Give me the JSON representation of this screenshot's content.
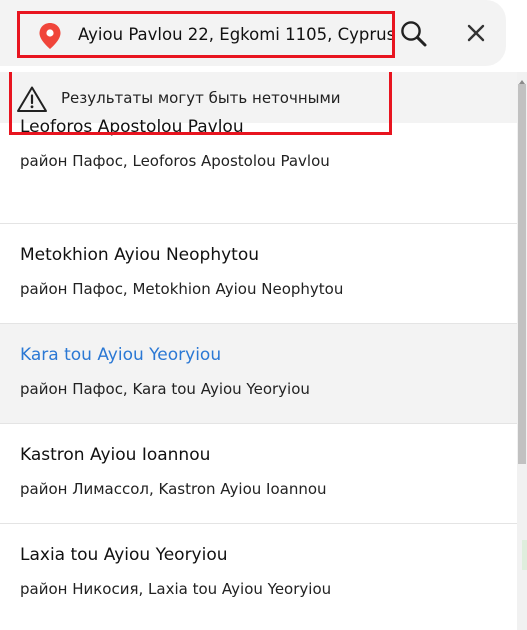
{
  "search": {
    "value": "Ayiou Pavlou 22, Egkomi 1105, Cyprus",
    "icons": {
      "location": "location-pin-icon",
      "search": "search-icon",
      "close": "close-icon"
    }
  },
  "warning": {
    "icon": "warning-triangle-icon",
    "text": "Результаты могут быть неточными"
  },
  "results": [
    {
      "title": "Leoforos Apostolou Pavlou",
      "subtitle": "район Пафос, Leoforos Apostolou Pavlou"
    },
    {
      "title": "Metokhion Ayiou Neophytou",
      "subtitle": "район Пафос, Metokhion Ayiou Neophytou"
    },
    {
      "title": "Kara tou Ayiou Yeoryiou",
      "subtitle": "район Пафос, Kara tou Ayiou Yeoryiou"
    },
    {
      "title": "Kastron Ayiou Ioannou",
      "subtitle": "район Лимассол, Kastron Ayiou Ioannou"
    },
    {
      "title": "Laxia tou Ayiou Yeoryiou",
      "subtitle": "район Никосия, Laxia tou Ayiou Yeoryiou"
    }
  ],
  "colors": {
    "highlight_border": "#e8141f",
    "active_title": "#2b78d4",
    "pin": "#f0453a",
    "panel_background": "#f3f3f3"
  }
}
